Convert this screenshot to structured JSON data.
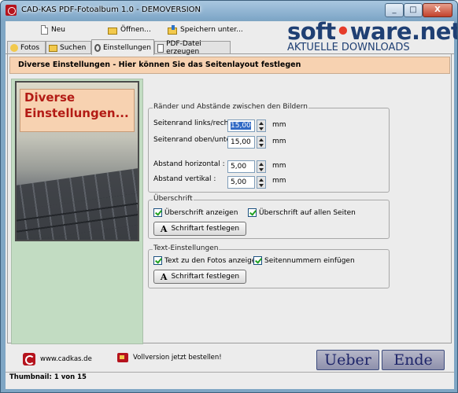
{
  "window": {
    "title": "CAD-KAS PDF-Fotoalbum 1.0 - DEMOVERSION",
    "controls": {
      "minimize": "_",
      "maximize": "□",
      "close": "X"
    }
  },
  "toolbar": {
    "new_label": "Neu",
    "open_label": "Öffnen...",
    "save_label": "Speichern unter..."
  },
  "logo": {
    "text_a": "soft",
    "text_dot": "•",
    "text_b": "ware.net",
    "tagline": "AKTUELLE DOWNLOADS"
  },
  "tabs": [
    {
      "label": "Fotos"
    },
    {
      "label": "Suchen"
    },
    {
      "label": "Einstellungen",
      "active": true
    },
    {
      "label": "PDF-Datei erzeugen"
    }
  ],
  "header": {
    "text": "Diverse Einstellungen - Hier können Sie das Seitenlayout festlegen"
  },
  "preview": {
    "caption_line1": "Diverse",
    "caption_line2": "Einstellungen..."
  },
  "margins": {
    "legend": "Ränder und Abstände zwischen den Bildern",
    "fields": [
      {
        "label": "Seitenrand links/rechts :",
        "value": "15,00",
        "unit": "mm"
      },
      {
        "label": "Seitenrand oben/unten :",
        "value": "15,00",
        "unit": "mm"
      },
      {
        "label": "Abstand horizontal :",
        "value": "5,00",
        "unit": "mm"
      },
      {
        "label": "Abstand vertikal :",
        "value": "5,00",
        "unit": "mm"
      }
    ]
  },
  "heading": {
    "legend": "Überschrift",
    "show_label": "Überschrift anzeigen",
    "show_checked": true,
    "all_pages_label": "Überschrift auf allen Seiten",
    "all_pages_checked": true,
    "font_button_icon": "A",
    "font_button": "Schriftart festlegen"
  },
  "text_settings": {
    "legend": "Text-Einstellungen",
    "show_text_label": "Text zu den Fotos anzeigen",
    "show_text_checked": true,
    "page_numbers_label": "Seitennummern einfügen",
    "page_numbers_checked": true,
    "font_button_icon": "A",
    "font_button": "Schriftart festlegen"
  },
  "footer": {
    "website": "www.cadkas.de",
    "order": "Vollversion jetzt bestellen!",
    "about_button": "Ueber",
    "exit_button": "Ende",
    "thumbnail_info": "Thumbnail: 1 von 15"
  }
}
